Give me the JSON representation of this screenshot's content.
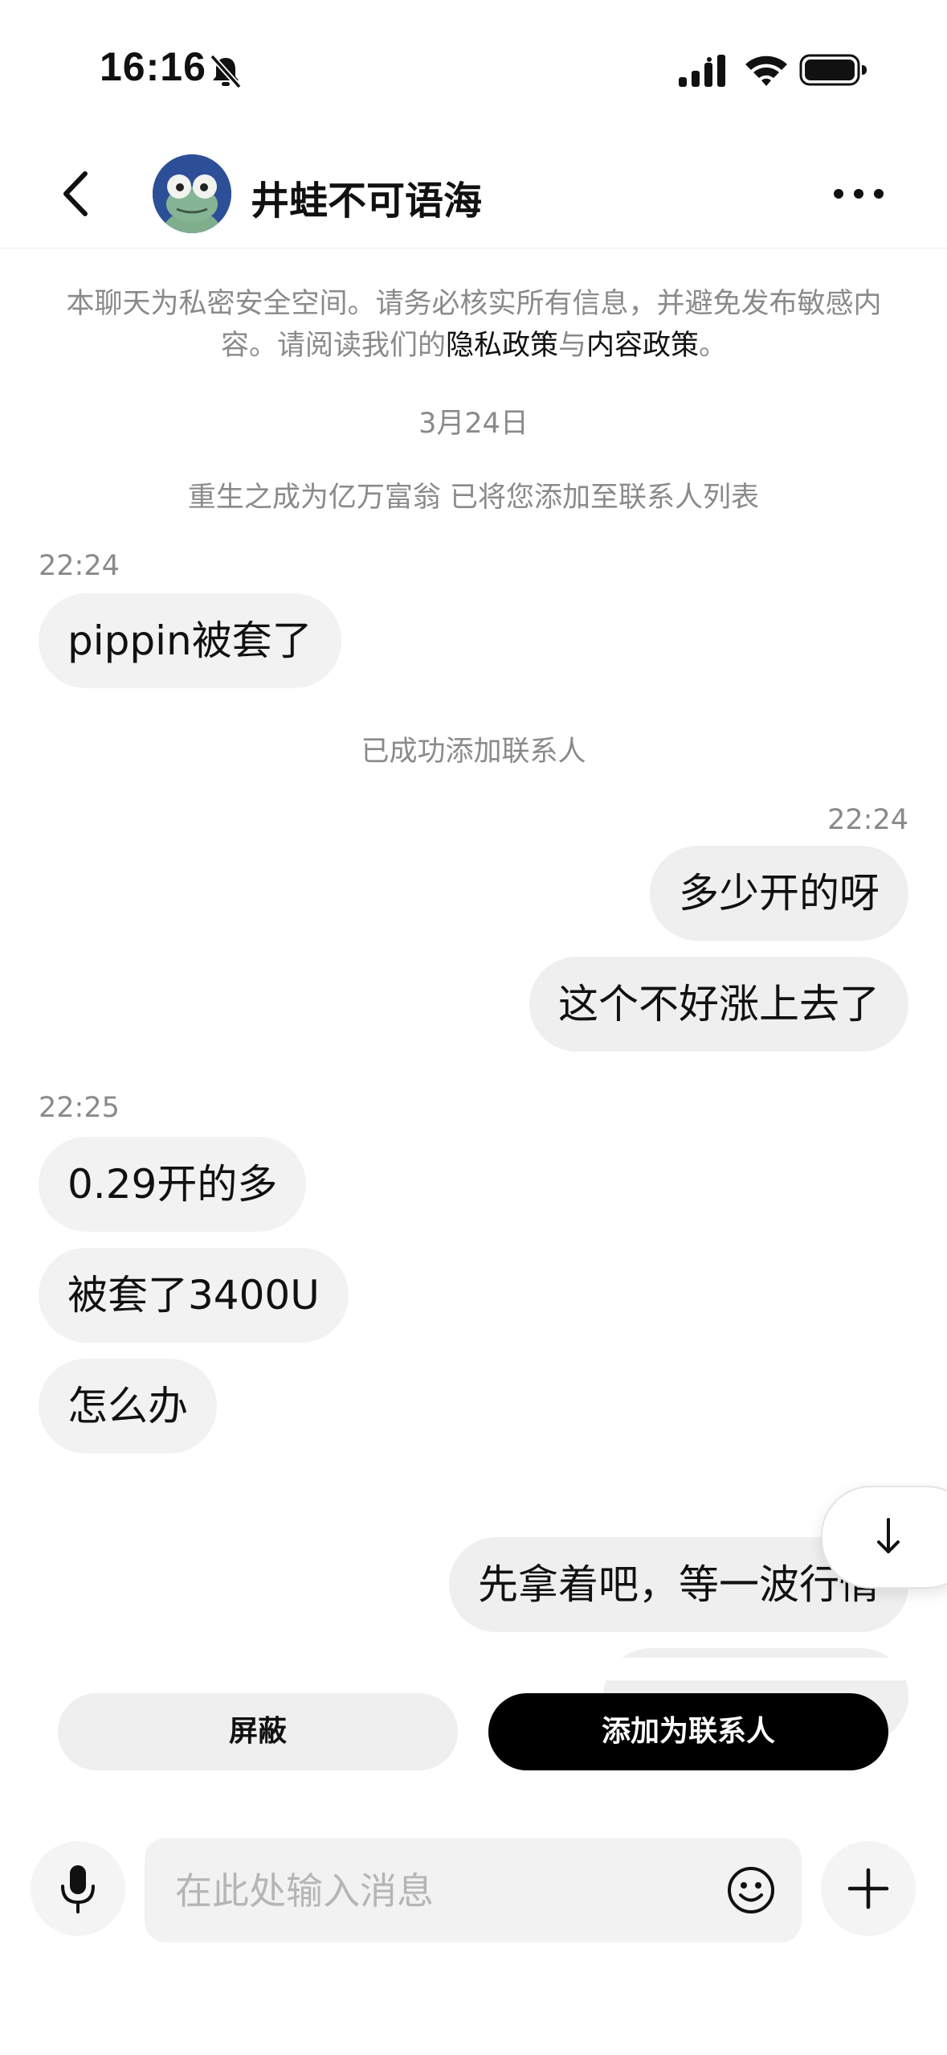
{
  "status_bar": {
    "time": "16:16"
  },
  "header": {
    "contact_name": "井蛙不可语海",
    "back_icon": "chevron-left-icon",
    "more_icon": "more-horizontal-icon"
  },
  "notice": {
    "text_before": "本聊天为私密安全空间。请务必核实所有信息，并避免发布敏感内容。请阅读我们的",
    "privacy_link": "隐私政策",
    "conjunction": "与",
    "content_link": "内容政策",
    "text_after": "。"
  },
  "chat": {
    "date": "3月24日",
    "system_added": "重生之成为亿万富翁 已将您添加至联系人列表",
    "time_1": "22:24",
    "msg_1": "pippin被套了",
    "system_success": "已成功添加联系人",
    "time_2": "22:24",
    "msg_2": "多少开的呀",
    "msg_3": "这个不好涨上去了",
    "time_3": "22:25",
    "msg_4": "0.29开的多",
    "msg_5": "被套了3400U",
    "msg_6": "怎么办",
    "msg_7": "先拿着吧，等一波行情"
  },
  "actions": {
    "block_label": "屏蔽",
    "add_contact_label": "添加为联系人"
  },
  "input_bar": {
    "placeholder": "在此处输入消息",
    "value": ""
  },
  "colors": {
    "bubble": "#f2f2f2",
    "primary_button": "#000000",
    "secondary_text": "#8a8a8a"
  }
}
